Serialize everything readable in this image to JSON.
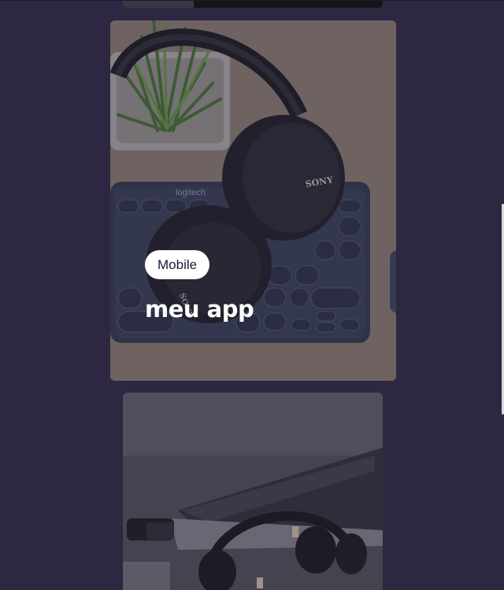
{
  "portfolio": {
    "cards": [
      {
        "category": "",
        "title": "",
        "image": "laptop-photo"
      },
      {
        "category": "Mobile",
        "title": "meu app",
        "image": "headphones-keyboard-photo",
        "hover": true
      },
      {
        "category": "",
        "title": "",
        "image": "headphones-laptop-photo"
      }
    ]
  },
  "colors": {
    "background": "#2d2742",
    "tag_background": "#ffffff",
    "tag_text": "#1f1a33",
    "title_text": "#ffffff"
  }
}
